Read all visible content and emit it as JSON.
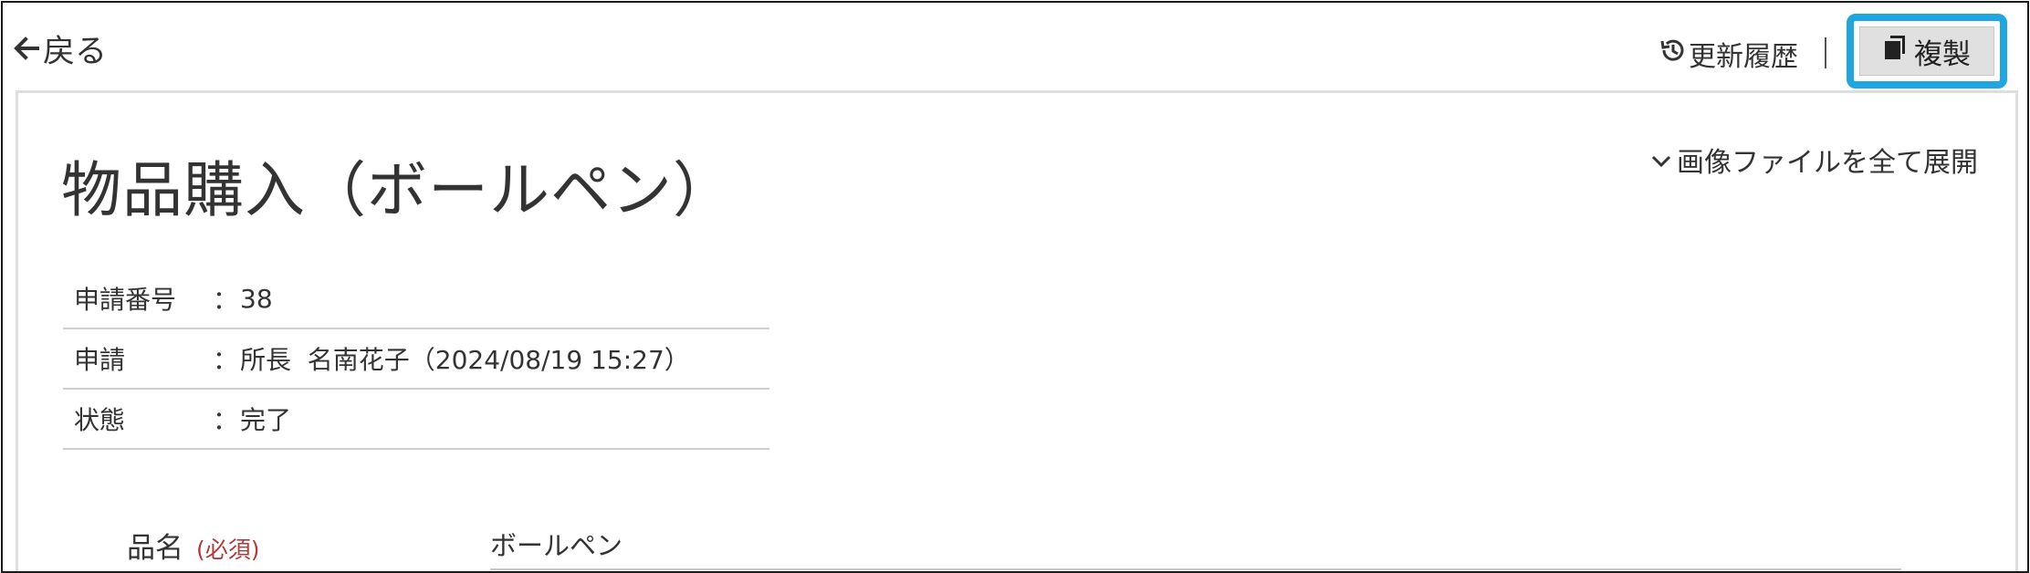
{
  "nav": {
    "back_label": "戻る"
  },
  "toolbar": {
    "history_label": "更新履歴",
    "separator": "|",
    "copy_label": "複製"
  },
  "header": {
    "title": "物品購入（ボールペン）",
    "expand_label": "画像ファイルを全て展開"
  },
  "info_rows": [
    {
      "key": "申請番号",
      "sep": "：",
      "value": "38"
    },
    {
      "key": "申請",
      "sep": "：",
      "value": "所長  名南花子（2024/08/19 15:27）"
    },
    {
      "key": "状態",
      "sep": "：",
      "value": "完了"
    }
  ],
  "form": {
    "item_name_label": "品名",
    "required_mark": "(必須)",
    "item_name_value": "ボールペン"
  },
  "colors": {
    "highlight": "#1fa6e0",
    "required": "#b23a3a"
  },
  "icons": [
    "arrow-left-icon",
    "history-icon",
    "copy-icon",
    "chevron-down-icon"
  ]
}
